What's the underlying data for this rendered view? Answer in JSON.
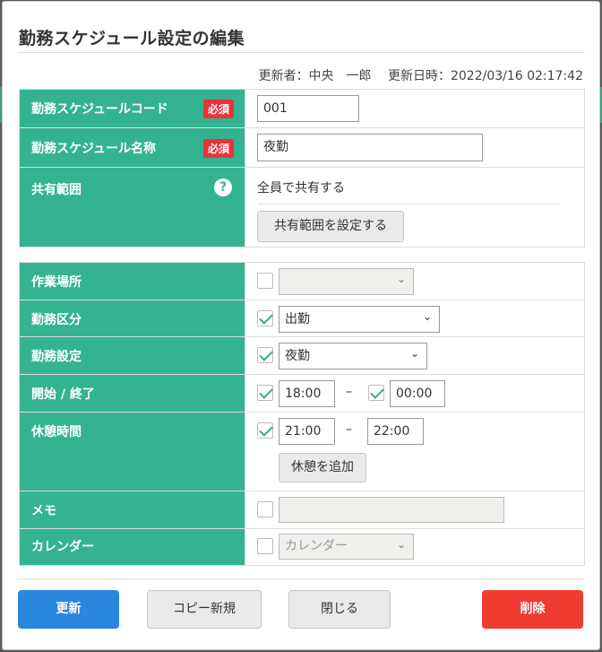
{
  "dialog": {
    "title": "勤務スケジュール設定の編集",
    "updated_by_label": "更新者：",
    "updated_by": "中央　一郎",
    "updated_at_label": "更新日時：",
    "updated_at": "2022/03/16 02:17:42"
  },
  "section1": {
    "code_label": "勤務スケジュールコード",
    "code_required": "必須",
    "code_value": "001",
    "name_label": "勤務スケジュール名称",
    "name_required": "必須",
    "name_value": "夜勤",
    "share_label": "共有範囲",
    "share_help_icon": "?",
    "share_value": "全員で共有する",
    "share_button": "共有範囲を設定する"
  },
  "section2": {
    "workplace_label": "作業場所",
    "workplace_checked": false,
    "workplace_value": "",
    "work_type_label": "勤務区分",
    "work_type_checked": true,
    "work_type_value": "出勤",
    "work_setting_label": "勤務設定",
    "work_setting_checked": true,
    "work_setting_value": "夜勤",
    "start_end_label": "開始 / 終了",
    "start_checked": true,
    "start_value": "18:00",
    "end_checked": true,
    "end_value": "00:00",
    "range_dash": "–",
    "break_label": "休憩時間",
    "break_checked": true,
    "break_start": "21:00",
    "break_end": "22:00",
    "add_break_button": "休憩を追加",
    "memo_label": "メモ",
    "memo_checked": false,
    "memo_value": "",
    "calendar_label": "カレンダー",
    "calendar_checked": false,
    "calendar_placeholder": "カレンダー"
  },
  "footer": {
    "update_button": "更新",
    "copy_button": "コピー新規",
    "close_button": "閉じる",
    "delete_button": "削除"
  },
  "colors": {
    "label_bg": "#34b391",
    "primary": "#2b86e0",
    "danger": "#f03b33",
    "required_badge": "#e8333a"
  }
}
